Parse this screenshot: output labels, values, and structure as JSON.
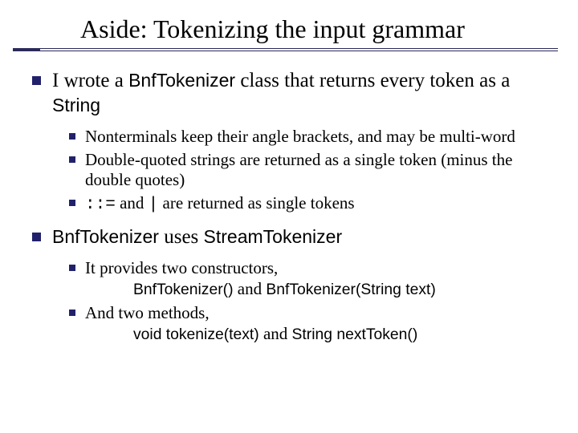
{
  "title": "Aside: Tokenizing the input grammar",
  "p1": {
    "pre": "I wrote a ",
    "cls": "BnfTokenizer",
    "mid": " class that returns every token as a ",
    "str": "String"
  },
  "p1sub": {
    "a": "Nonterminals keep their angle brackets, and may be multi-word",
    "b": "Double-quoted strings are returned as a single token (minus the double quotes)",
    "c_code1": "::=",
    "c_mid": " and ",
    "c_code2": "|",
    "c_tail": " are returned as single tokens"
  },
  "p2": {
    "cls": "BnfTokenizer",
    "mid": " uses ",
    "st": "StreamTokenizer"
  },
  "p2sub": {
    "a_lead": "It provides two constructors,",
    "a_c1": "BnfTokenizer()",
    "a_and": " and ",
    "a_c2": "BnfTokenizer(String text)",
    "b_lead": "And two methods,",
    "b_m1": "void tokenize(text)",
    "b_and": " and ",
    "b_m2": "String nextToken()"
  }
}
